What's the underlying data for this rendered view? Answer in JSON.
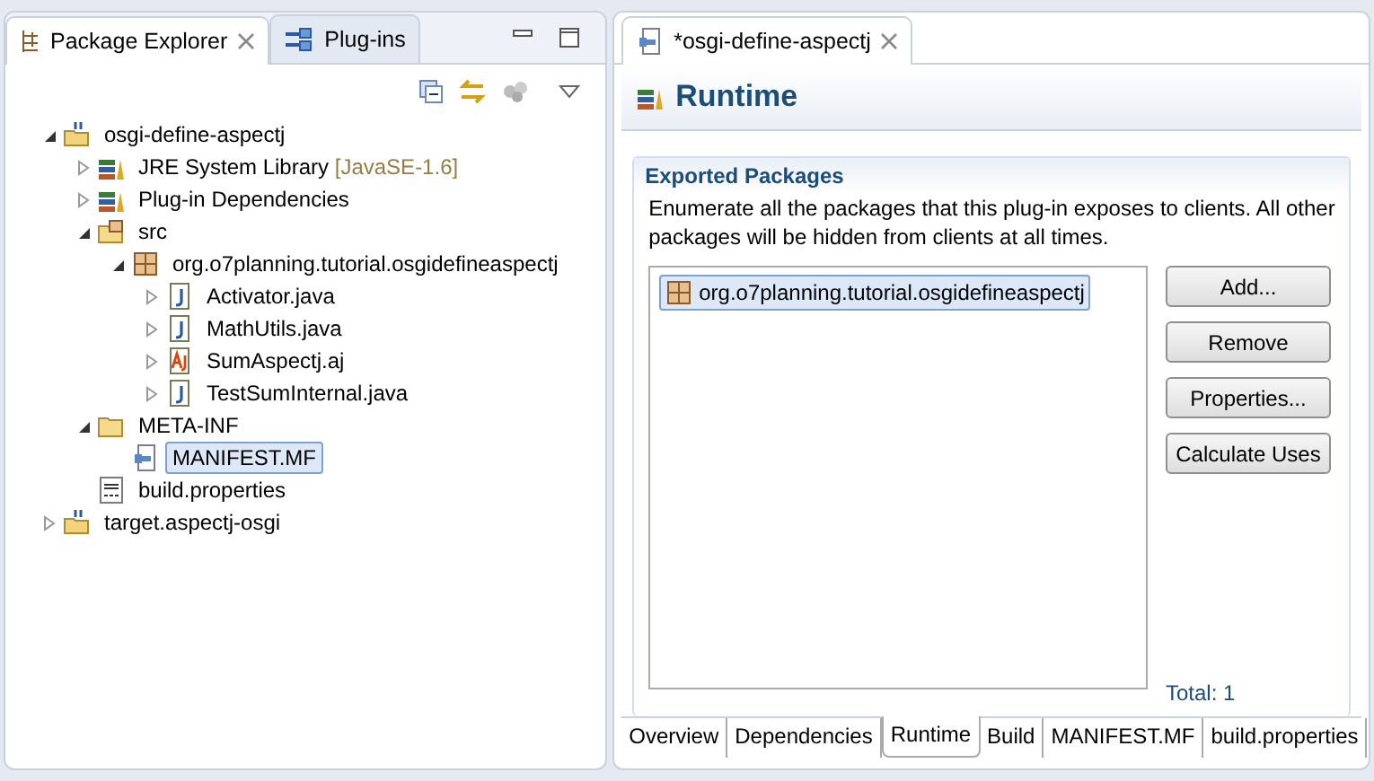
{
  "explorer": {
    "tabs": [
      {
        "label": "Package Explorer",
        "selected": true,
        "kind": "explorer"
      },
      {
        "label": "Plug-ins",
        "selected": false,
        "kind": "plugins"
      }
    ],
    "tree": [
      {
        "label": "osgi-define-aspectj",
        "kind": "project",
        "expanded": true,
        "selected": false,
        "children": [
          {
            "label": "JRE System Library",
            "decoration": "[JavaSE-1.6]",
            "kind": "library",
            "expanded": false,
            "selected": false
          },
          {
            "label": "Plug-in Dependencies",
            "kind": "library",
            "expanded": false,
            "selected": false
          },
          {
            "label": "src",
            "kind": "srcfolder",
            "expanded": true,
            "selected": false,
            "children": [
              {
                "label": "org.o7planning.tutorial.osgidefineaspectj",
                "kind": "package",
                "expanded": true,
                "selected": false,
                "children": [
                  {
                    "label": "Activator.java",
                    "kind": "java",
                    "expanded": false,
                    "selected": false
                  },
                  {
                    "label": "MathUtils.java",
                    "kind": "java",
                    "expanded": false,
                    "selected": false
                  },
                  {
                    "label": "SumAspectj.aj",
                    "kind": "aj",
                    "expanded": false,
                    "selected": false
                  },
                  {
                    "label": "TestSumInternal.java",
                    "kind": "java",
                    "expanded": false,
                    "selected": false
                  }
                ]
              }
            ]
          },
          {
            "label": "META-INF",
            "kind": "folder",
            "expanded": true,
            "selected": false,
            "children": [
              {
                "label": "MANIFEST.MF",
                "kind": "manifest",
                "selected": true
              }
            ]
          },
          {
            "label": "build.properties",
            "kind": "properties",
            "selected": false
          }
        ]
      },
      {
        "label": "target.aspectj-osgi",
        "kind": "project",
        "expanded": false,
        "selected": false
      }
    ]
  },
  "editor": {
    "tab": {
      "label": "*osgi-define-aspectj",
      "selected": true
    },
    "title": "Runtime",
    "section": {
      "title": "Exported Packages",
      "description": "Enumerate all the packages that this plug-in exposes to clients.  All other packages will be hidden from clients at all times.",
      "packages": [
        {
          "label": "org.o7planning.tutorial.osgidefineaspectj",
          "selected": true
        }
      ],
      "buttons": [
        "Add...",
        "Remove",
        "Properties...",
        "Calculate Uses"
      ],
      "total": "Total: 1"
    },
    "pages": [
      {
        "label": "Overview",
        "selected": false
      },
      {
        "label": "Dependencies",
        "selected": false
      },
      {
        "label": "Runtime",
        "selected": true
      },
      {
        "label": "Build",
        "selected": false
      },
      {
        "label": "MANIFEST.MF",
        "selected": false
      },
      {
        "label": "build.properties",
        "selected": false
      }
    ]
  }
}
